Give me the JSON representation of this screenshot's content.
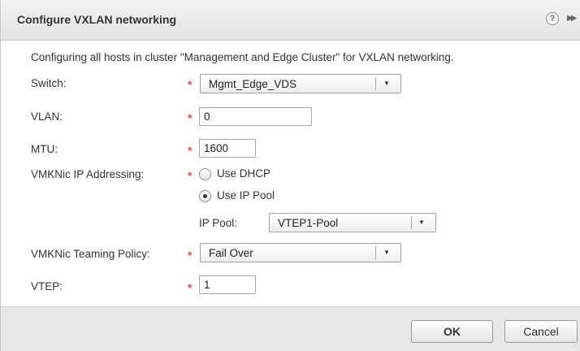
{
  "dialog": {
    "title": "Configure VXLAN networking",
    "help_icon": "?",
    "expand_icon": "▶▶"
  },
  "form": {
    "intro": "Configuring all hosts in cluster \"Management and Edge Cluster\" for VXLAN networking.",
    "required_marker": "*",
    "switch": {
      "label": "Switch:",
      "value": "Mgmt_Edge_VDS"
    },
    "vlan": {
      "label": "VLAN:",
      "value": "0"
    },
    "mtu": {
      "label": "MTU:",
      "value": "1600"
    },
    "vmknic_ip": {
      "label": "VMKNic IP Addressing:",
      "options": [
        {
          "label": "Use DHCP",
          "selected": false
        },
        {
          "label": "Use IP Pool",
          "selected": true
        }
      ],
      "ip_pool": {
        "label": "IP Pool:",
        "value": "VTEP1-Pool"
      }
    },
    "teaming": {
      "label": "VMKNic Teaming Policy:",
      "value": "Fail Over"
    },
    "vtep": {
      "label": "VTEP:",
      "value": "1"
    }
  },
  "footer": {
    "ok_label": "OK",
    "cancel_label": "Cancel"
  },
  "colors": {
    "required": "#d9534f",
    "titlebar": "#e9e9e9",
    "footer": "#e8e8e8"
  }
}
